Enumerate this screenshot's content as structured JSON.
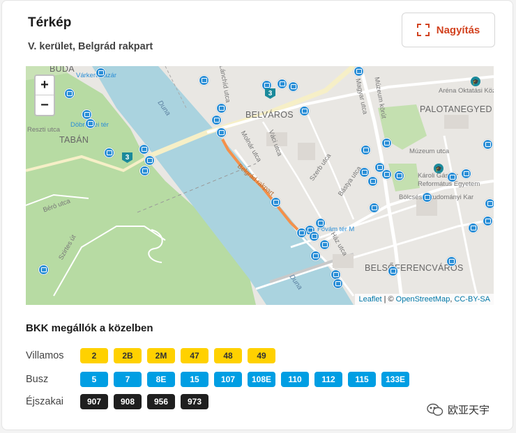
{
  "header": {
    "title": "Térkép",
    "subtitle": "V. kerület, Belgrád rakpart",
    "zoom_button_label": "Nagyítás"
  },
  "map": {
    "zoom_in": "+",
    "zoom_out": "−",
    "labels": {
      "buda": "BUDA",
      "varkert": "Várkert Bazár",
      "dobrentei": "Döbrentei tér",
      "tabán": "TABÁN",
      "belvaros": "BELVÁROS",
      "palotanegyed": "PALOTANEGYED",
      "belsoferencvaros": "BELSŐFERENCVÁROS",
      "duna1": "Duna",
      "duna2": "Duna",
      "muzeum_korut": "Múzeum körút",
      "muzeum_utca": "Múzeum utca",
      "magyar_utca": "Magyar utca",
      "varoshaz": "Váci utca",
      "molnar": "Molnár utca",
      "belgrad": "Belgrád rakpart",
      "szerb": "Szerb utca",
      "bastya": "Bástya utca",
      "bero": "Béró utca",
      "szirtes": "Szirtes út",
      "karoli": "Károli Gáspár Református Egyetem",
      "bolcs": "Bölcsészettudományi Kar",
      "arena": "Aréna Oktatási Köz",
      "fovam": "Fővám tér M",
      "haz": "Ház utca",
      "resztulca": "Reszti utca",
      "lanc": "Lánchíd utca"
    },
    "tram_route_number": "3",
    "attribution": {
      "leaflet": "Leaflet",
      "sep": " | © ",
      "osm": "OpenStreetMap",
      "comma": ", ",
      "license": "CC-BY-SA"
    },
    "colors": {
      "water": "#aad3df",
      "park": "#b7dba3",
      "route": "#f4904a",
      "stop": "#2a8ed6"
    }
  },
  "stops_section": {
    "title": "BKK megállók a közelben",
    "rows": [
      {
        "label": "Villamos",
        "type": "tram",
        "lines": [
          "2",
          "2B",
          "2M",
          "47",
          "48",
          "49"
        ]
      },
      {
        "label": "Busz",
        "type": "bus",
        "lines": [
          "5",
          "7",
          "8E",
          "15",
          "107",
          "108E",
          "110",
          "112",
          "115",
          "133E"
        ]
      },
      {
        "label": "Éjszakai",
        "type": "night",
        "lines": [
          "907",
          "908",
          "956",
          "973"
        ]
      }
    ]
  },
  "watermark": "欧亚天宇"
}
